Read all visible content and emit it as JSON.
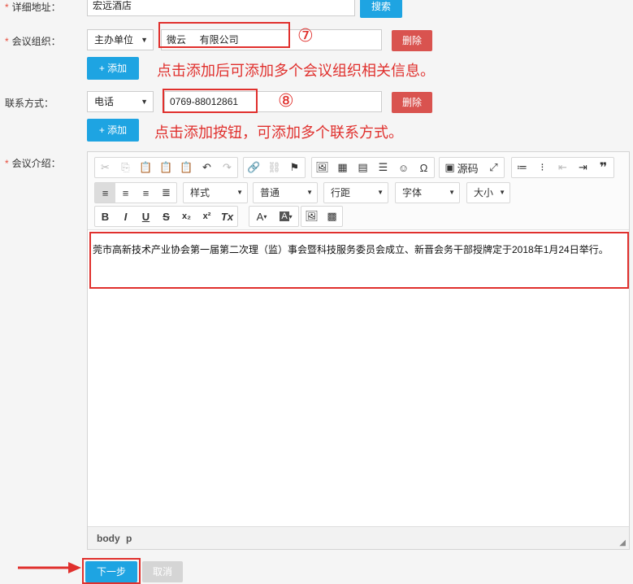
{
  "form": {
    "address": {
      "label": "详细地址：",
      "value": "宏远酒店",
      "search_label": "搜索"
    },
    "organizer": {
      "label": "会议组织：",
      "select": "主办单位",
      "value": "微云     有限公司",
      "delete_label": "删除",
      "add_label": "+ 添加",
      "marker": "⑦",
      "hint": "点击添加后可添加多个会议组织相关信息。"
    },
    "contact": {
      "label": "联系方式：",
      "select": "电话",
      "value": "0769-88012861",
      "delete_label": "删除",
      "add_label": "+ 添加",
      "marker": "⑧",
      "hint": "点击添加按钮，可添加多个联系方式。"
    },
    "intro": {
      "label": "会议介绍：",
      "content": "莞市高新技术产业协会第一届第二次理（监）事会暨科技服务委员会成立、新晋会务干部授牌定于2018年1月24日举行。",
      "statusbar_body": "body",
      "statusbar_p": "p"
    },
    "required_mark": "*"
  },
  "toolbar": {
    "source_label": "源码",
    "style_label": "样式",
    "normal_label": "普通",
    "line_height_label": "行距",
    "font_label": "字体",
    "size_label": "大小"
  },
  "footer": {
    "next_label": "下一步",
    "cancel_label": "取消"
  },
  "colors": {
    "primary": "#1ea4e2",
    "danger": "#d9534f",
    "annotation": "#e0302d"
  }
}
